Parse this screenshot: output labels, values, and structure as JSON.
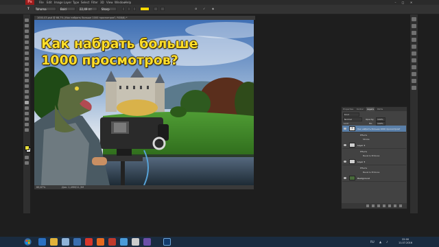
{
  "menubar": {
    "app_logo": "Ps",
    "items": [
      "File",
      "Edit",
      "Image",
      "Layer",
      "Type",
      "Select",
      "Filter",
      "3D",
      "View",
      "Window",
      "Help"
    ],
    "window_controls": [
      "–",
      "□",
      "✕"
    ]
  },
  "options": {
    "tool_label": "T",
    "font_family": "Tahoma",
    "font_style": "Bold",
    "font_size": "22,49 пт",
    "antialias": "Sharp",
    "text_color": "#ffd800"
  },
  "document": {
    "tab_title": "1000-03.psd @ 66,7% (Как набрать больше 1000 просмотров?, RGB/8) *",
    "canvas_text_line1": "Как набрать больше",
    "canvas_text_line2": "1000 просмотров?",
    "zoom": "66,67%",
    "doc_size": "Док: 1,49М/11,3М"
  },
  "layers_panel": {
    "tabs": [
      "Properties",
      "Kontur",
      "Layers",
      "Paths"
    ],
    "active_tab": "Layers",
    "filter": "Kind",
    "blend_mode": "Normal",
    "opacity_label": "Opacity:",
    "opacity": "100%",
    "lock_label": "Lock:",
    "fill_label": "Fill:",
    "fill": "100%",
    "layers": [
      {
        "name": "Как набрать больше 1000 просмотров?",
        "thumb": "T",
        "selected": true
      },
      {
        "name": "Effects",
        "sub": true
      },
      {
        "name": "Stroke",
        "sub": true
      },
      {
        "name": "Layer 4"
      },
      {
        "name": "Effects",
        "sub": true
      },
      {
        "name": "Bevel & Emboss",
        "sub": true
      },
      {
        "name": "Layer 3"
      },
      {
        "name": "Effects",
        "sub": true
      },
      {
        "name": "Bevel & Emboss",
        "sub": true
      },
      {
        "name": "Background"
      }
    ]
  },
  "taskbar": {
    "language": "RU",
    "time": "22:00",
    "date": "11.07.2016"
  },
  "colors": {
    "accent_text": "#ffde2a",
    "layer_selected": "#5a7fa8",
    "taskbar": "#1a2b3f"
  }
}
